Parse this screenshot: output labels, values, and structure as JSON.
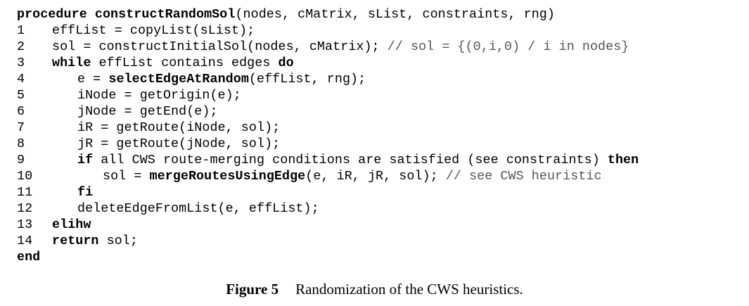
{
  "algorithm": {
    "header": [
      {
        "t": "procedure",
        "b": true
      },
      {
        "t": " "
      },
      {
        "t": "constructRandomSol",
        "b": true
      },
      {
        "t": "(nodes, cMatrix, sList, constraints, rng)"
      }
    ],
    "lines": [
      {
        "n": "1",
        "indent": 1,
        "segs": [
          {
            "t": "effList = copyList(sList);"
          }
        ]
      },
      {
        "n": "2",
        "indent": 1,
        "segs": [
          {
            "t": "sol = constructInitialSol(nodes, cMatrix); "
          },
          {
            "t": "// sol = {(0,i,0) / i in nodes}",
            "c": true
          }
        ]
      },
      {
        "n": "3",
        "indent": 1,
        "segs": [
          {
            "t": "while",
            "b": true
          },
          {
            "t": " effList contains edges "
          },
          {
            "t": "do",
            "b": true
          }
        ]
      },
      {
        "n": "4",
        "indent": 2,
        "segs": [
          {
            "t": "e = "
          },
          {
            "t": "selectEdgeAtRandom",
            "b": true
          },
          {
            "t": "(effList, rng);"
          }
        ]
      },
      {
        "n": "5",
        "indent": 2,
        "segs": [
          {
            "t": "iNode = getOrigin(e);"
          }
        ]
      },
      {
        "n": "6",
        "indent": 2,
        "segs": [
          {
            "t": "jNode = getEnd(e);"
          }
        ]
      },
      {
        "n": "7",
        "indent": 2,
        "segs": [
          {
            "t": "iR = getRoute(iNode, sol);"
          }
        ]
      },
      {
        "n": "8",
        "indent": 2,
        "segs": [
          {
            "t": "jR = getRoute(jNode, sol);"
          }
        ]
      },
      {
        "n": "9",
        "indent": 2,
        "segs": [
          {
            "t": "if",
            "b": true
          },
          {
            "t": " all CWS route-merging conditions are satisfied (see constraints) "
          },
          {
            "t": "then",
            "b": true
          }
        ]
      },
      {
        "n": "10",
        "indent": 3,
        "segs": [
          {
            "t": "sol = "
          },
          {
            "t": "mergeRoutesUsingEdge",
            "b": true
          },
          {
            "t": "(e, iR, jR, sol); "
          },
          {
            "t": "// see CWS heuristic",
            "c": true
          }
        ]
      },
      {
        "n": "11",
        "indent": 2,
        "segs": [
          {
            "t": "fi",
            "b": true
          }
        ]
      },
      {
        "n": "12",
        "indent": 2,
        "segs": [
          {
            "t": "deleteEdgeFromList(e, effList);"
          }
        ]
      },
      {
        "n": "13",
        "indent": 1,
        "segs": [
          {
            "t": "elihw",
            "b": true
          }
        ]
      },
      {
        "n": "14",
        "indent": 1,
        "segs": [
          {
            "t": "return",
            "b": true
          },
          {
            "t": " sol;"
          }
        ]
      }
    ],
    "footer": [
      {
        "t": "end",
        "b": true
      }
    ]
  },
  "caption": {
    "label": "Figure 5",
    "text": "Randomization of the CWS heuristics."
  }
}
